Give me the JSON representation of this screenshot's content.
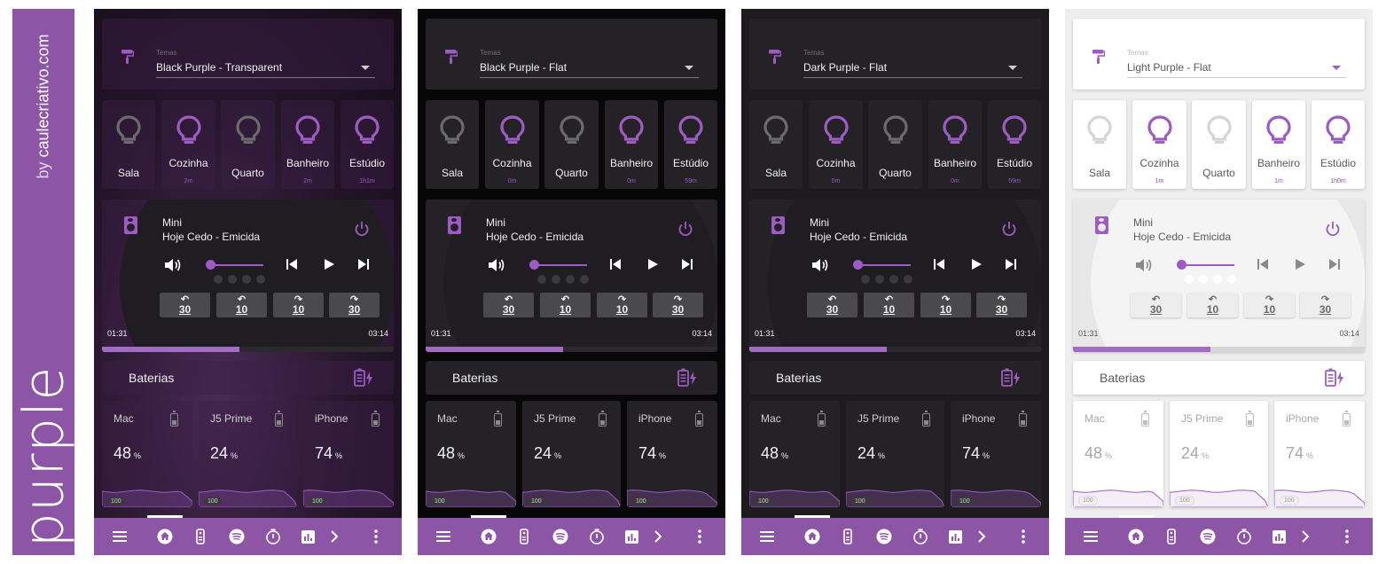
{
  "sidebar": {
    "by_prefix": "by",
    "author": "caulecriativo.com",
    "title": "purple"
  },
  "colors": {
    "accent": "#9c5cc2",
    "nav": "#8c55a6",
    "bulb_off_dark": "#6b6b6b",
    "bulb_off_light": "#d5d5d5"
  },
  "panels": [
    {
      "variant": "dark transparent",
      "bg": "bg-tr",
      "theme_caption": "Temas",
      "theme_value": "Black Purple - Transparent",
      "lights": [
        {
          "name": "Sala",
          "time": "",
          "on": false
        },
        {
          "name": "Cozinha",
          "time": "2m",
          "on": true
        },
        {
          "name": "Quarto",
          "time": "",
          "on": false
        },
        {
          "name": "Banheiro",
          "time": "2m",
          "on": true
        },
        {
          "name": "Estúdio",
          "time": "1h1m",
          "on": true
        }
      ],
      "media": {
        "name": "Mini",
        "song": "Hoje Cedo - Emicida",
        "current": "01:31",
        "duration": "03:14",
        "progress": 0.47,
        "seek": [
          {
            "dir": "↶",
            "num": "30"
          },
          {
            "dir": "↶",
            "num": "10"
          },
          {
            "dir": "↷",
            "num": "10"
          },
          {
            "dir": "↷",
            "num": "30"
          }
        ]
      },
      "batteries_title": "Baterias",
      "devices": [
        {
          "name": "Mac",
          "value": "48",
          "unit": "%",
          "badge": "100",
          "level": 0.48
        },
        {
          "name": "J5 Prime",
          "value": "24",
          "unit": "%",
          "badge": "100",
          "level": 0.24
        },
        {
          "name": "iPhone",
          "value": "74",
          "unit": "%",
          "badge": "100",
          "level": 0.74
        }
      ]
    },
    {
      "variant": "dark",
      "bg": "bg-flat-black",
      "theme_caption": "Temas",
      "theme_value": "Black Purple - Flat",
      "lights": [
        {
          "name": "Sala",
          "time": "",
          "on": false
        },
        {
          "name": "Cozinha",
          "time": "0m",
          "on": true
        },
        {
          "name": "Quarto",
          "time": "",
          "on": false
        },
        {
          "name": "Banheiro",
          "time": "0m",
          "on": true
        },
        {
          "name": "Estúdio",
          "time": "59m",
          "on": true
        }
      ],
      "media": {
        "name": "Mini",
        "song": "Hoje Cedo - Emicida",
        "current": "01:31",
        "duration": "03:14",
        "progress": 0.47,
        "seek": [
          {
            "dir": "↶",
            "num": "30"
          },
          {
            "dir": "↶",
            "num": "10"
          },
          {
            "dir": "↷",
            "num": "10"
          },
          {
            "dir": "↷",
            "num": "30"
          }
        ]
      },
      "batteries_title": "Baterias",
      "devices": [
        {
          "name": "Mac",
          "value": "48",
          "unit": "%",
          "badge": "100",
          "level": 0.48
        },
        {
          "name": "J5 Prime",
          "value": "24",
          "unit": "%",
          "badge": "100",
          "level": 0.24
        },
        {
          "name": "iPhone",
          "value": "74",
          "unit": "%",
          "badge": "100",
          "level": 0.74
        }
      ]
    },
    {
      "variant": "dark",
      "bg": "bg-flat-dark",
      "theme_caption": "Temas",
      "theme_value": "Dark Purple - Flat",
      "lights": [
        {
          "name": "Sala",
          "time": "",
          "on": false
        },
        {
          "name": "Cozinha",
          "time": "0m",
          "on": true
        },
        {
          "name": "Quarto",
          "time": "",
          "on": false
        },
        {
          "name": "Banheiro",
          "time": "0m",
          "on": true
        },
        {
          "name": "Estúdio",
          "time": "59m",
          "on": true
        }
      ],
      "media": {
        "name": "Mini",
        "song": "Hoje Cedo - Emicida",
        "current": "01:31",
        "duration": "03:14",
        "progress": 0.47,
        "seek": [
          {
            "dir": "↶",
            "num": "30"
          },
          {
            "dir": "↶",
            "num": "10"
          },
          {
            "dir": "↷",
            "num": "10"
          },
          {
            "dir": "↷",
            "num": "30"
          }
        ]
      },
      "batteries_title": "Baterias",
      "devices": [
        {
          "name": "Mac",
          "value": "48",
          "unit": "%",
          "badge": "100",
          "level": 0.48
        },
        {
          "name": "J5 Prime",
          "value": "24",
          "unit": "%",
          "badge": "100",
          "level": 0.24
        },
        {
          "name": "iPhone",
          "value": "74",
          "unit": "%",
          "badge": "100",
          "level": 0.74
        }
      ]
    },
    {
      "variant": "light",
      "bg": "bg-light",
      "theme_caption": "Temas",
      "theme_value": "Light Purple - Flat",
      "lights": [
        {
          "name": "Sala",
          "time": "",
          "on": false
        },
        {
          "name": "Cozinha",
          "time": "1m",
          "on": true
        },
        {
          "name": "Quarto",
          "time": "",
          "on": false
        },
        {
          "name": "Banheiro",
          "time": "1m",
          "on": true
        },
        {
          "name": "Estúdio",
          "time": "1h0m",
          "on": true
        }
      ],
      "media": {
        "name": "Mini",
        "song": "Hoje Cedo - Emicida",
        "current": "01:31",
        "duration": "03:14",
        "progress": 0.47,
        "seek": [
          {
            "dir": "↶",
            "num": "30"
          },
          {
            "dir": "↶",
            "num": "10"
          },
          {
            "dir": "↷",
            "num": "10"
          },
          {
            "dir": "↷",
            "num": "30"
          }
        ]
      },
      "batteries_title": "Baterias",
      "devices": [
        {
          "name": "Mac",
          "value": "48",
          "unit": "%",
          "badge": "100",
          "level": 0.48
        },
        {
          "name": "J5 Prime",
          "value": "24",
          "unit": "%",
          "badge": "100",
          "level": 0.24
        },
        {
          "name": "iPhone",
          "value": "74",
          "unit": "%",
          "badge": "100",
          "level": 0.74
        }
      ]
    }
  ],
  "nav_items": [
    "menu-icon",
    "home-icon",
    "remote-icon",
    "spotify-icon",
    "timer-icon",
    "chart-icon",
    "chevron-right-icon",
    "more-vert-icon"
  ]
}
